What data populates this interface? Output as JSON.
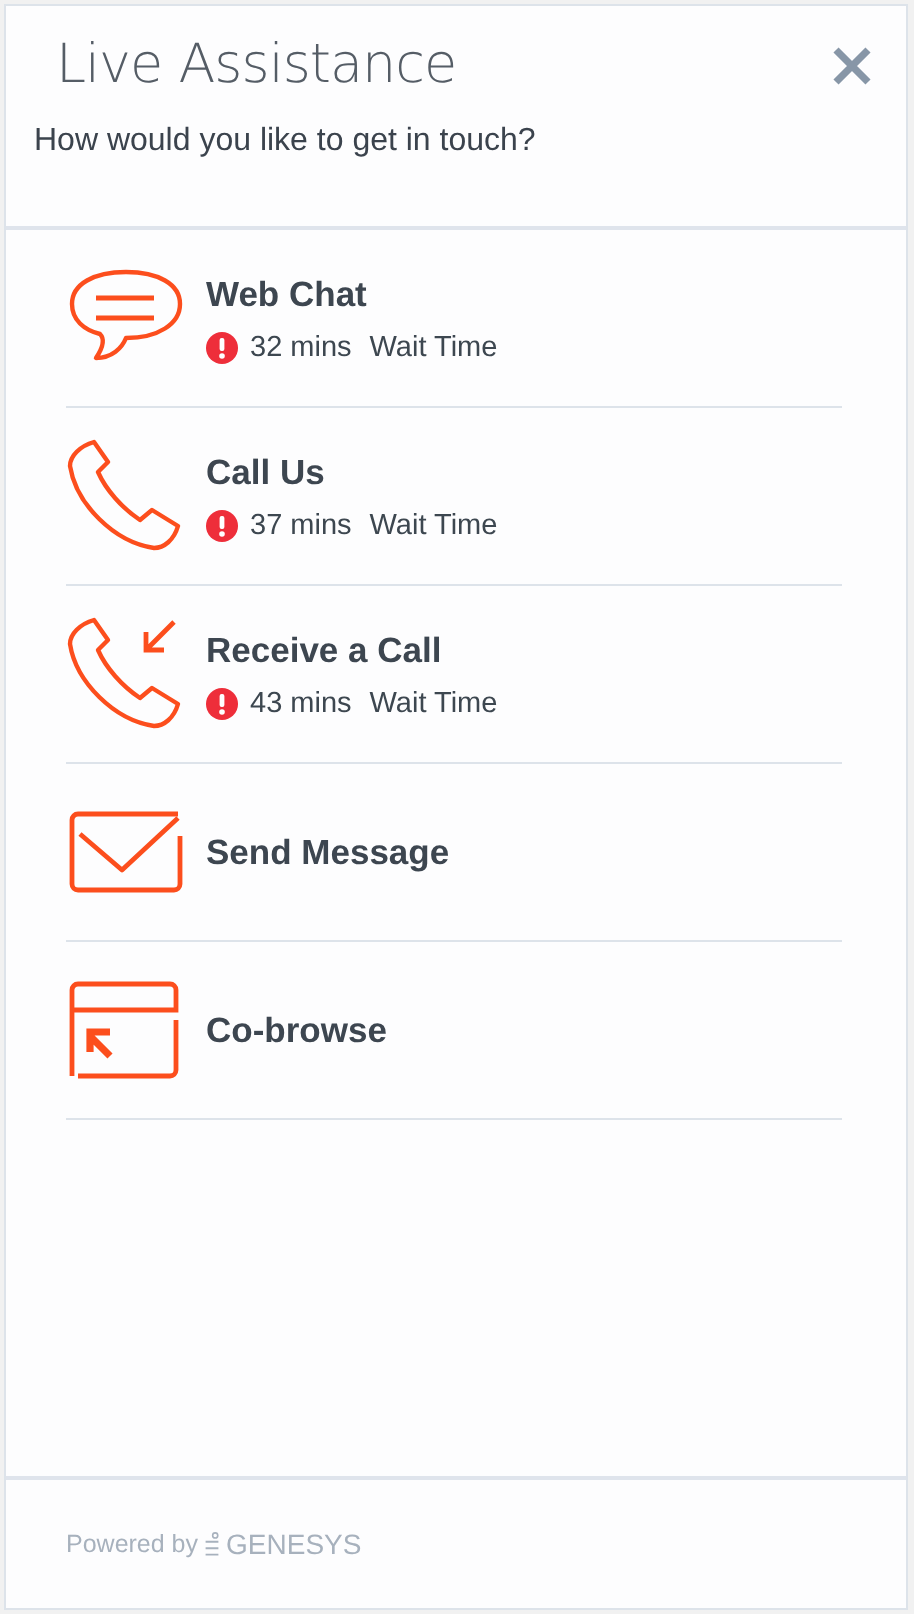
{
  "header": {
    "title": "Live Assistance",
    "subtitle": "How would you like to get in touch?"
  },
  "options": [
    {
      "kind": "chat",
      "label": "Web Chat",
      "wait": "32 mins",
      "wait_label": "Wait Time"
    },
    {
      "kind": "call",
      "label": "Call Us",
      "wait": "37 mins",
      "wait_label": "Wait Time"
    },
    {
      "kind": "callback",
      "label": "Receive a Call",
      "wait": "43 mins",
      "wait_label": "Wait Time"
    },
    {
      "kind": "email",
      "label": "Send Message"
    },
    {
      "kind": "cobrowse",
      "label": "Co-browse"
    }
  ],
  "footer": {
    "powered_by": "Powered by",
    "brand": "GENESYS"
  }
}
